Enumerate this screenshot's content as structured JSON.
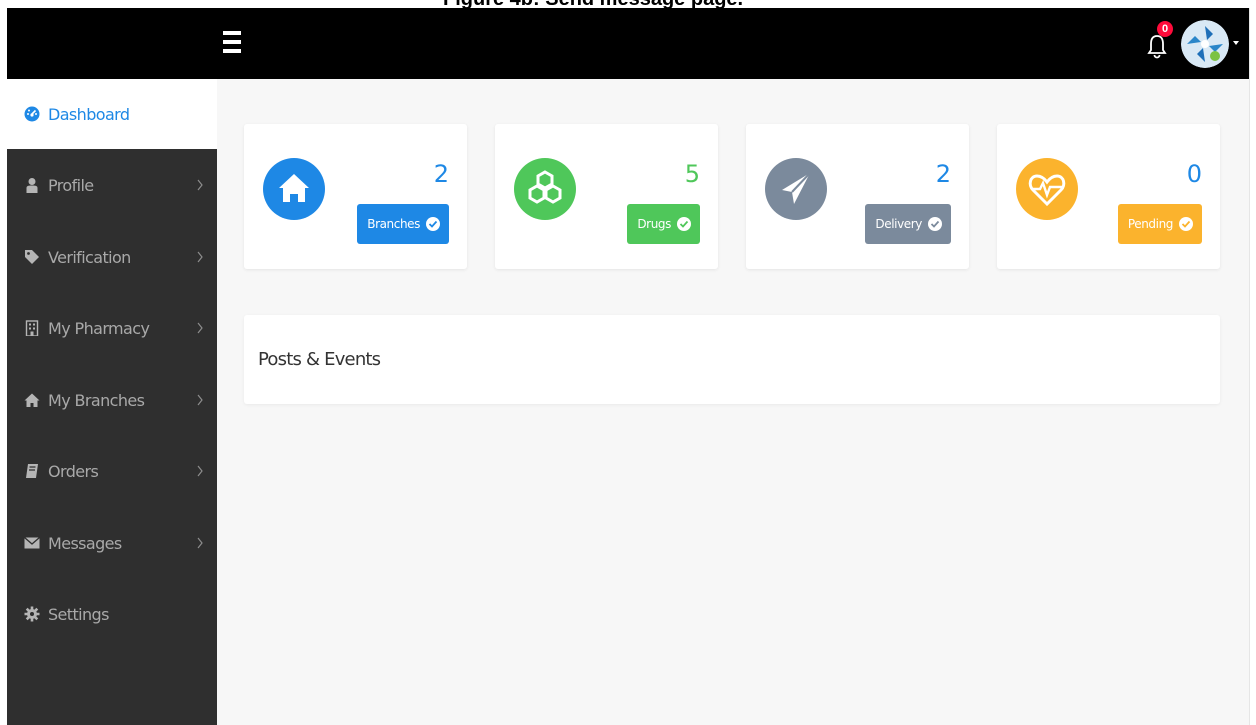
{
  "caption": {
    "text": "Figure 4b: Send message page."
  },
  "header": {
    "notifications_count": "0",
    "accent_badge": "#ff0b3b"
  },
  "sidebar": {
    "items": [
      {
        "label": "Dashboard",
        "icon": "dashboard-icon",
        "active": true,
        "has_chevron": false
      },
      {
        "label": "Profile",
        "icon": "user-icon",
        "active": false,
        "has_chevron": true
      },
      {
        "label": "Verification",
        "icon": "tag-icon",
        "active": false,
        "has_chevron": true
      },
      {
        "label": "My Pharmacy",
        "icon": "building-icon",
        "active": false,
        "has_chevron": true
      },
      {
        "label": "My Branches",
        "icon": "home-icon",
        "active": false,
        "has_chevron": true
      },
      {
        "label": "Orders",
        "icon": "book-icon",
        "active": false,
        "has_chevron": true
      },
      {
        "label": "Messages",
        "icon": "envelope-icon",
        "active": false,
        "has_chevron": true
      },
      {
        "label": "Settings",
        "icon": "gear-icon",
        "active": false,
        "has_chevron": false
      }
    ]
  },
  "stats": [
    {
      "count": "2",
      "label": "Branches",
      "icon": "home-icon",
      "color": "#1e88e5"
    },
    {
      "count": "5",
      "label": "Drugs",
      "icon": "cubes-icon",
      "color": "#4fc75a"
    },
    {
      "count": "2",
      "label": "Delivery",
      "icon": "paper-plane-icon",
      "color": "#7b8a9c"
    },
    {
      "count": "0",
      "label": "Pending",
      "icon": "heartbeat-icon",
      "color": "#fbb32d"
    }
  ],
  "posts": {
    "title": "Posts & Events"
  }
}
